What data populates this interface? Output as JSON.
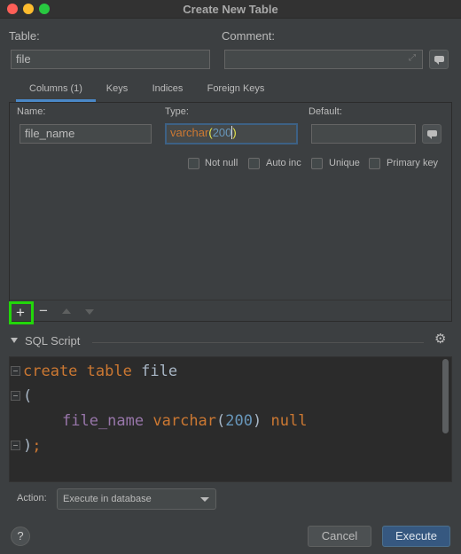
{
  "window": {
    "title": "Create New Table"
  },
  "form": {
    "table_label": "Table:",
    "table_value": "file",
    "comment_label": "Comment:",
    "comment_value": ""
  },
  "tabs": [
    {
      "label": "Columns (1)",
      "active": true
    },
    {
      "label": "Keys",
      "active": false
    },
    {
      "label": "Indices",
      "active": false
    },
    {
      "label": "Foreign Keys",
      "active": false
    }
  ],
  "column_editor": {
    "name_label": "Name:",
    "name_value": "file_name",
    "type_label": "Type:",
    "type_keyword": "varchar",
    "type_open": "(",
    "type_size": "200",
    "type_close": ")",
    "default_label": "Default:",
    "default_value": "",
    "checkboxes": [
      {
        "label": "Not null",
        "checked": false
      },
      {
        "label": "Auto inc",
        "checked": false
      },
      {
        "label": "Unique",
        "checked": false
      },
      {
        "label": "Primary key",
        "checked": false
      }
    ]
  },
  "toolbar": {
    "add_icon": "+",
    "remove_icon": "−"
  },
  "sql_script": {
    "section_label": "SQL Script",
    "gear_icon": "⚙",
    "lines": [
      {
        "kw1": "create",
        "kw2": "table",
        "ident": "file"
      },
      {
        "punct": "("
      },
      {
        "col": "file_name",
        "type": "varchar",
        "open": "(",
        "num": "200",
        "close": ")",
        "kw": "null"
      },
      {
        "close": ")",
        "semi": ";"
      }
    ]
  },
  "action": {
    "label": "Action:",
    "selected": "Execute in database"
  },
  "footer": {
    "help": "?",
    "cancel": "Cancel",
    "execute": "Execute"
  },
  "colors": {
    "accent_blue": "#4a88c7",
    "highlight_green": "#22d60a",
    "keyword": "#cc7832",
    "number": "#6897bb",
    "column": "#9876aa"
  }
}
